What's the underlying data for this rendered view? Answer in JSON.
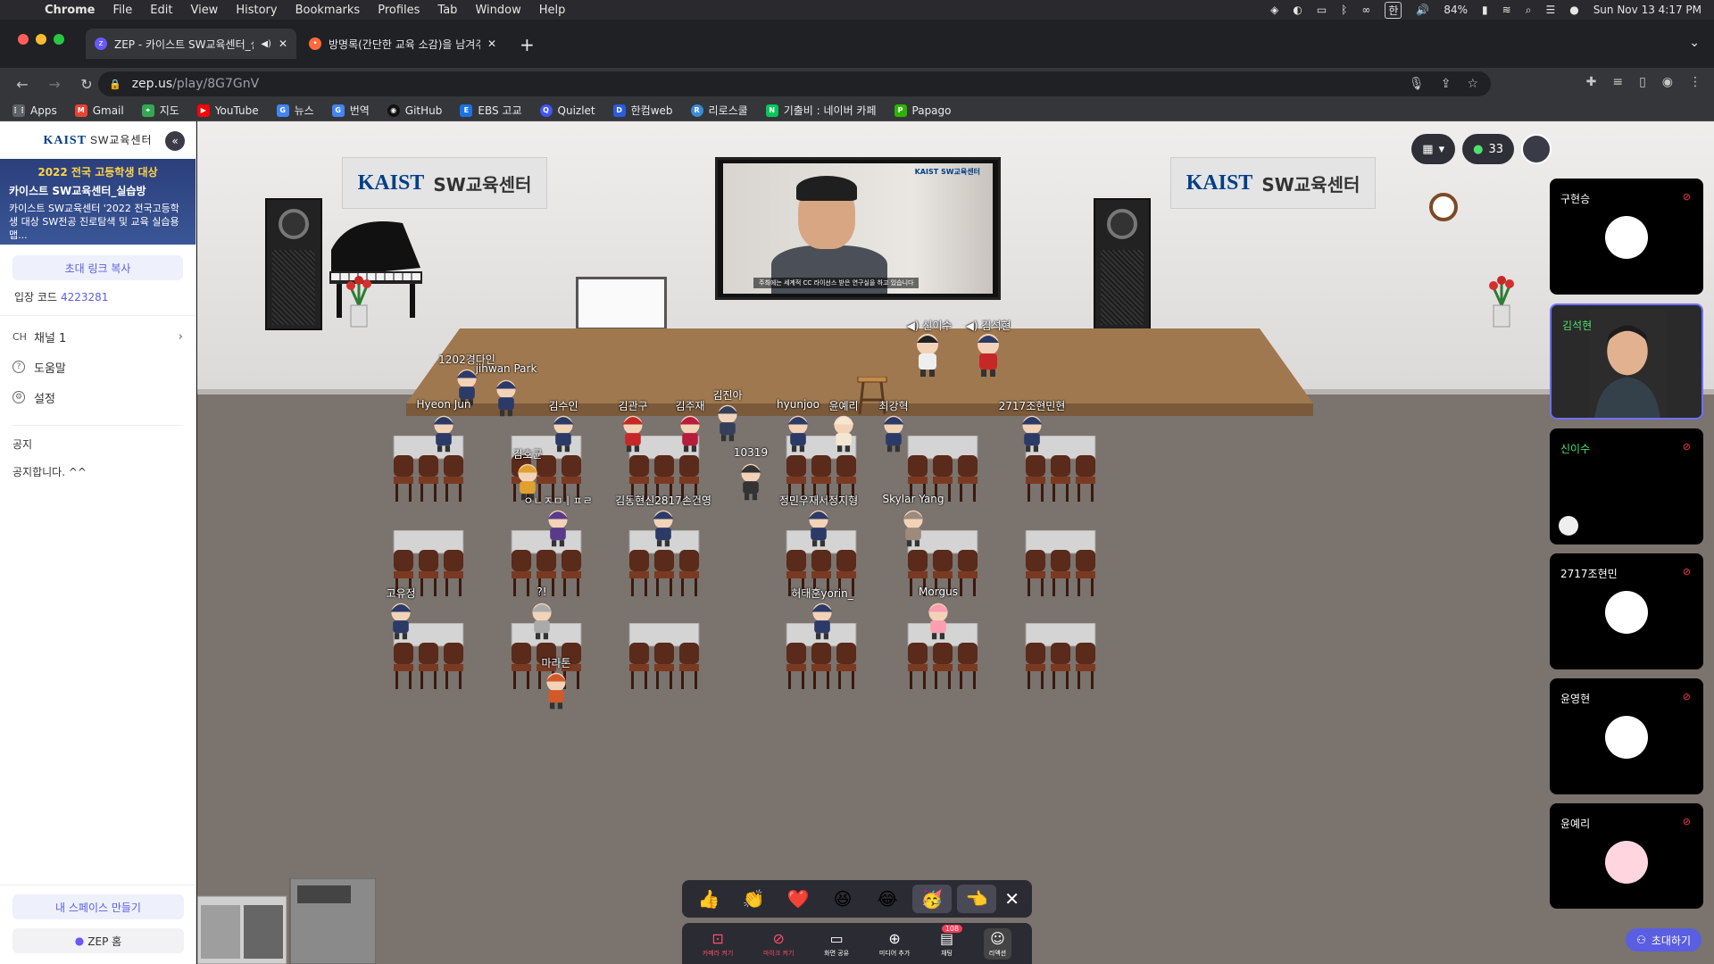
{
  "menubar": {
    "app": "Chrome",
    "items": [
      "File",
      "Edit",
      "View",
      "History",
      "Bookmarks",
      "Profiles",
      "Tab",
      "Window",
      "Help"
    ],
    "battery": "84%",
    "input_lang": "한",
    "datetime": "Sun Nov 13  4:17 PM"
  },
  "tabs": [
    {
      "title": "ZEP - 카이스트 SW교육센터_실습",
      "active": true
    },
    {
      "title": "방명록(간단한 교육 소감)을 남겨주세",
      "active": false
    }
  ],
  "address": {
    "host": "zep.us",
    "path": "/play/8G7GnV"
  },
  "bookmarks": [
    "Apps",
    "Gmail",
    "지도",
    "YouTube",
    "뉴스",
    "번역",
    "GitHub",
    "EBS 고교",
    "Quizlet",
    "한컴web",
    "리로스쿨",
    "기출비 : 네이버 카페",
    "Papago"
  ],
  "sidebar": {
    "logo_main": "KAIST",
    "logo_sub": "SW교육센터",
    "banner_top": "2022 전국 고등학생 대상",
    "banner_title": "카이스트 SW교육센터_실습방",
    "banner_desc": "카이스트 SW교육센터 '2022 전국고등학생 대상 SW전공 진로탐색 및 교육 실습용 맵...",
    "invite_button": "초대 링크 복사",
    "entry_label": "입장 코드",
    "entry_code": "4223281",
    "channel_prefix": "CH",
    "channel": "채널 1",
    "help": "도움말",
    "settings": "설정",
    "notice_title": "공지",
    "notice_text": "공지합니다. ^^",
    "make_space": "내 스페이스 만들기",
    "zep_home": "ZEP 홈"
  },
  "stage": {
    "poster_main": "KAIST",
    "poster_sub": "SW교육센터",
    "screen_logo": "KAIST SW교육센터",
    "screen_subtitle": "주최에는 세계적 CC 라이선스 받은 연구실을 하고 있습니다",
    "speaker1": "신이수",
    "speaker2": "김석현",
    "names": [
      "1202경다인",
      "jihwan Park",
      "Hyeon Jun",
      "김수인",
      "김관구",
      "김주재",
      "김진아",
      "hyunjoo",
      "윤예리",
      "최강혁",
      "2717조현민현",
      "김호균",
      "10319",
      "ㅇㄴㅈㅁㅣㅍㄹ",
      "김동현신2817손건영",
      "정민우재서정지형",
      "Skylar Yang",
      "고유정",
      "?!",
      "허태훈yorin_",
      "Morgus",
      "마라톤"
    ]
  },
  "controls": {
    "participants": "33"
  },
  "videos": [
    {
      "name": "구현승",
      "live": false,
      "green": false
    },
    {
      "name": "김석현",
      "live": true,
      "green": true
    },
    {
      "name": "신이수",
      "live": false,
      "green": true
    },
    {
      "name": "2717조현민",
      "live": false,
      "green": false
    },
    {
      "name": "윤영현",
      "live": false,
      "green": false
    },
    {
      "name": "윤예리",
      "live": false,
      "green": false
    }
  ],
  "reactions": [
    "👍",
    "👏",
    "❤️",
    "😆",
    "😂",
    "🥳",
    "👈"
  ],
  "bottombar": {
    "camera": "카메라 켜기",
    "mic": "마이크 켜기",
    "screen_share": "화면 공유",
    "media_add": "미디어 추가",
    "chat": "채팅",
    "chat_badge": "108",
    "reaction": "리액션"
  },
  "invite_corner": "초대하기"
}
